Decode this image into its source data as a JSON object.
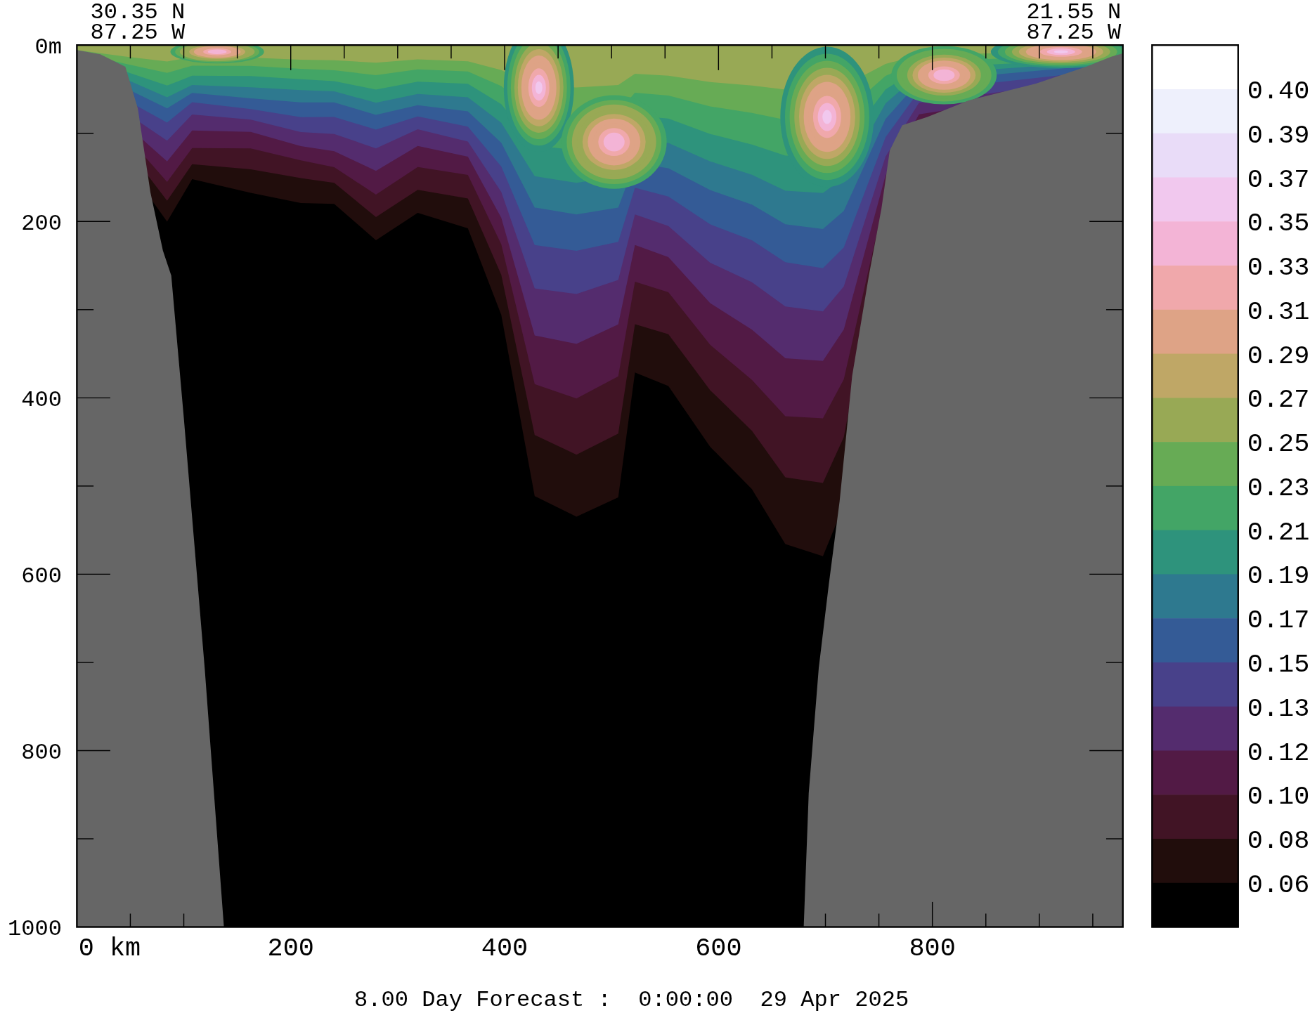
{
  "header": {
    "left": [
      "30.35 N",
      "87.25 W"
    ],
    "right": [
      "21.55 N",
      "87.25 W"
    ]
  },
  "y_axis": {
    "labels": [
      "0m",
      "200",
      "400",
      "600",
      "800",
      "1000"
    ]
  },
  "x_axis": {
    "labels": [
      "0 km",
      "200",
      "400",
      "600",
      "800"
    ]
  },
  "colorbar": {
    "bands": [
      {
        "color": "#eef0fc"
      },
      {
        "color": "#e9dcf8"
      },
      {
        "color": "#f1c8ee"
      },
      {
        "color": "#f3b4d6"
      },
      {
        "color": "#f0a8ab"
      },
      {
        "color": "#dea386"
      },
      {
        "color": "#bfa766"
      },
      {
        "color": "#98a955"
      },
      {
        "color": "#67ab55"
      },
      {
        "color": "#43a566"
      },
      {
        "color": "#2e937c"
      },
      {
        "color": "#2e798f"
      },
      {
        "color": "#345b96"
      },
      {
        "color": "#48418a"
      },
      {
        "color": "#542c6e"
      },
      {
        "color": "#521a45"
      },
      {
        "color": "#411425"
      },
      {
        "color": "#210d0c"
      },
      {
        "color": "#000000"
      }
    ],
    "labels": [
      "0.40",
      "0.39",
      "0.37",
      "0.35",
      "0.33",
      "0.31",
      "0.29",
      "0.27",
      "0.25",
      "0.23",
      "0.21",
      "0.19",
      "0.17",
      "0.15",
      "0.13",
      "0.12",
      "0.10",
      "0.08",
      "0.06"
    ]
  },
  "footer": "8.00 Day Forecast :  0:00:00  29 Apr 2025"
}
